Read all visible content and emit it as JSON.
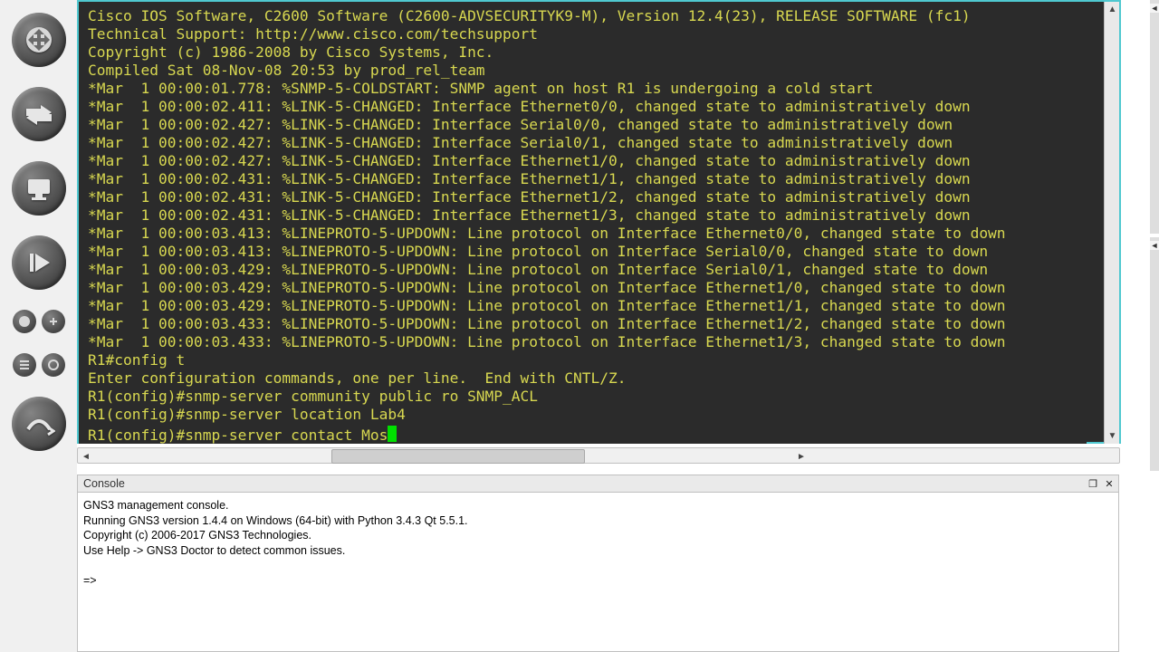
{
  "toolbar": {
    "icons": [
      "router",
      "arrows",
      "monitor",
      "step",
      "double-circle",
      "cable"
    ]
  },
  "terminal_lines": [
    "Cisco IOS Software, C2600 Software (C2600-ADVSECURITYK9-M), Version 12.4(23), RELEASE SOFTWARE (fc1)",
    "Technical Support: http://www.cisco.com/techsupport",
    "Copyright (c) 1986-2008 by Cisco Systems, Inc.",
    "Compiled Sat 08-Nov-08 20:53 by prod_rel_team",
    "*Mar  1 00:00:01.778: %SNMP-5-COLDSTART: SNMP agent on host R1 is undergoing a cold start",
    "*Mar  1 00:00:02.411: %LINK-5-CHANGED: Interface Ethernet0/0, changed state to administratively down",
    "*Mar  1 00:00:02.427: %LINK-5-CHANGED: Interface Serial0/0, changed state to administratively down",
    "*Mar  1 00:00:02.427: %LINK-5-CHANGED: Interface Serial0/1, changed state to administratively down",
    "*Mar  1 00:00:02.427: %LINK-5-CHANGED: Interface Ethernet1/0, changed state to administratively down",
    "*Mar  1 00:00:02.431: %LINK-5-CHANGED: Interface Ethernet1/1, changed state to administratively down",
    "*Mar  1 00:00:02.431: %LINK-5-CHANGED: Interface Ethernet1/2, changed state to administratively down",
    "*Mar  1 00:00:02.431: %LINK-5-CHANGED: Interface Ethernet1/3, changed state to administratively down",
    "*Mar  1 00:00:03.413: %LINEPROTO-5-UPDOWN: Line protocol on Interface Ethernet0/0, changed state to down",
    "*Mar  1 00:00:03.413: %LINEPROTO-5-UPDOWN: Line protocol on Interface Serial0/0, changed state to down",
    "*Mar  1 00:00:03.429: %LINEPROTO-5-UPDOWN: Line protocol on Interface Serial0/1, changed state to down",
    "*Mar  1 00:00:03.429: %LINEPROTO-5-UPDOWN: Line protocol on Interface Ethernet1/0, changed state to down",
    "*Mar  1 00:00:03.429: %LINEPROTO-5-UPDOWN: Line protocol on Interface Ethernet1/1, changed state to down",
    "*Mar  1 00:00:03.433: %LINEPROTO-5-UPDOWN: Line protocol on Interface Ethernet1/2, changed state to down",
    "*Mar  1 00:00:03.433: %LINEPROTO-5-UPDOWN: Line protocol on Interface Ethernet1/3, changed state to down",
    "R1#config t",
    "Enter configuration commands, one per line.  End with CNTL/Z.",
    "R1(config)#snmp-server community public ro SNMP_ACL",
    "R1(config)#snmp-server location Lab4"
  ],
  "terminal_input_line": "R1(config)#snmp-server contact Mos",
  "console": {
    "title": "Console",
    "lines": [
      "GNS3 management console.",
      "Running GNS3 version 1.4.4 on Windows (64-bit) with Python 3.4.3 Qt 5.5.1.",
      "Copyright (c) 2006-2017 GNS3 Technologies.",
      "Use Help -> GNS3 Doctor to detect common issues.",
      "",
      "=>"
    ]
  }
}
